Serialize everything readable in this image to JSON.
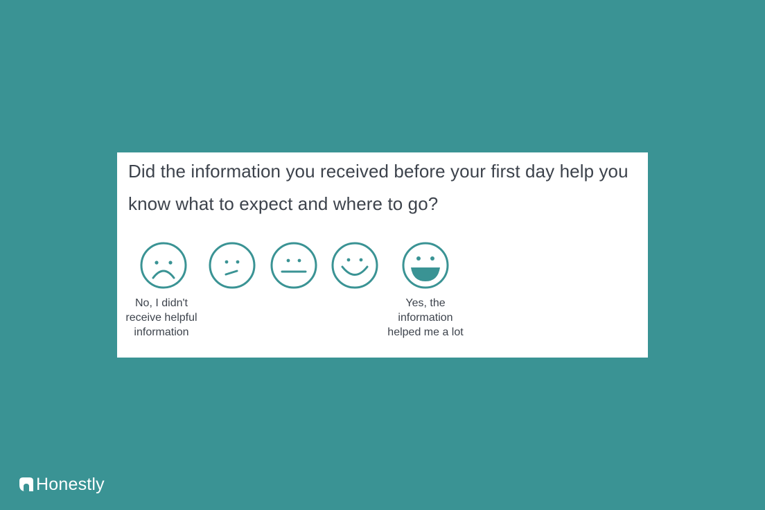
{
  "colors": {
    "background": "#3a9394",
    "card": "#ffffff",
    "face_stroke": "#3a9394",
    "text": "#3d434c",
    "brand_text": "#ffffff"
  },
  "survey": {
    "question": "Did the information you received before your first day help you know what to expect and where to go?",
    "options": [
      {
        "icon": "very-sad-face-icon",
        "caption": "No, I didn't receive helpful information"
      },
      {
        "icon": "unsure-face-icon",
        "caption": ""
      },
      {
        "icon": "neutral-face-icon",
        "caption": ""
      },
      {
        "icon": "smile-face-icon",
        "caption": ""
      },
      {
        "icon": "big-smile-face-icon",
        "caption": "Yes, the information helped me a lot"
      }
    ]
  },
  "brand": {
    "icon": "honestly-logo-icon",
    "name": "Honestly"
  }
}
